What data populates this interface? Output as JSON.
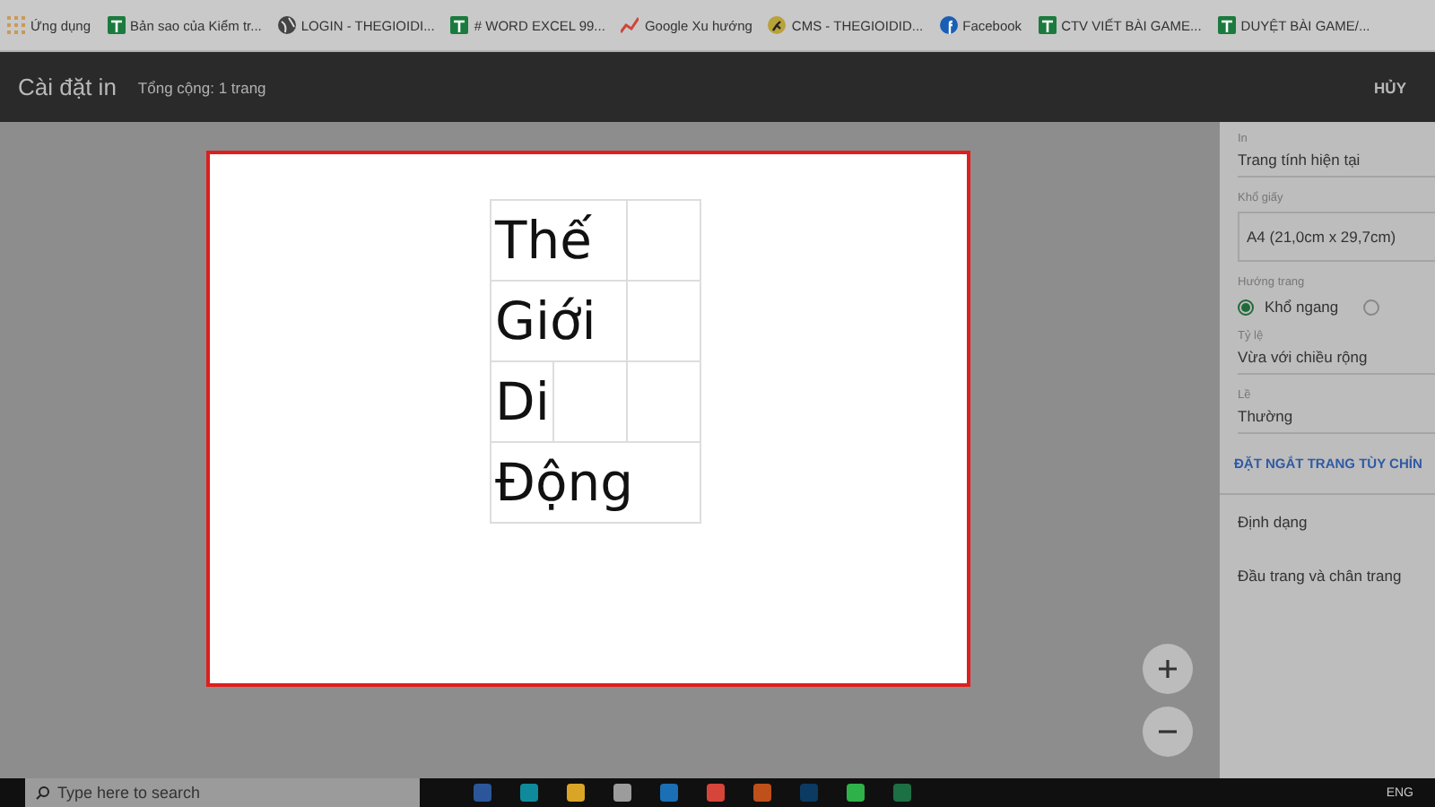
{
  "bookmarks": [
    {
      "kind": "apps",
      "label": "Ứng dụng"
    },
    {
      "kind": "sheet",
      "label": "Bản sao của Kiểm tr..."
    },
    {
      "kind": "globe",
      "label": "LOGIN - THEGIOIDI..."
    },
    {
      "kind": "sheet",
      "label": "# WORD EXCEL 99..."
    },
    {
      "kind": "trend",
      "label": "Google Xu hướng"
    },
    {
      "kind": "cms",
      "label": "CMS - THEGIOIDID..."
    },
    {
      "kind": "facebook",
      "label": "Facebook"
    },
    {
      "kind": "sheet",
      "label": "CTV VIẾT BÀI GAME..."
    },
    {
      "kind": "sheet",
      "label": "DUYỆT BÀI GAME/..."
    }
  ],
  "header": {
    "title": "Cài đặt in",
    "total": "Tổng cộng: 1 trang",
    "cancel": "HỦY"
  },
  "preview": {
    "rows": [
      [
        "Thế",
        ""
      ],
      [
        "Giới",
        ""
      ],
      [
        "Di",
        "",
        ""
      ],
      [
        "Động"
      ]
    ]
  },
  "settings": {
    "print": {
      "label": "In",
      "value": "Trang tính hiện tại"
    },
    "paper": {
      "label": "Khổ giấy",
      "value": "A4 (21,0cm x 29,7cm)"
    },
    "orientation": {
      "label": "Hướng trang",
      "options": [
        {
          "label": "Khổ ngang",
          "selected": true
        },
        {
          "selected": false
        }
      ]
    },
    "scale": {
      "label": "Tỷ lệ",
      "value": "Vừa với chiều rộng"
    },
    "margins": {
      "label": "Lề",
      "value": "Thường"
    },
    "link": "ĐẶT NGẮT TRANG TÙY CHỈN",
    "sections": [
      "Định dạng",
      "Đầu trang và chân trang"
    ]
  },
  "taskbar": {
    "search_placeholder": "Type here to search",
    "apps": [
      {
        "color": "#2b579a"
      },
      {
        "color": "#0f8a9c"
      },
      {
        "color": "#d8a526"
      },
      {
        "color": "#9c9c9c"
      },
      {
        "color": "#1a6fb5"
      },
      {
        "color": "#d6453a"
      },
      {
        "color": "#c0501a"
      },
      {
        "color": "#0b3a63"
      },
      {
        "color": "#2fb14a"
      },
      {
        "color": "#1d7044"
      }
    ],
    "language": "ENG"
  }
}
